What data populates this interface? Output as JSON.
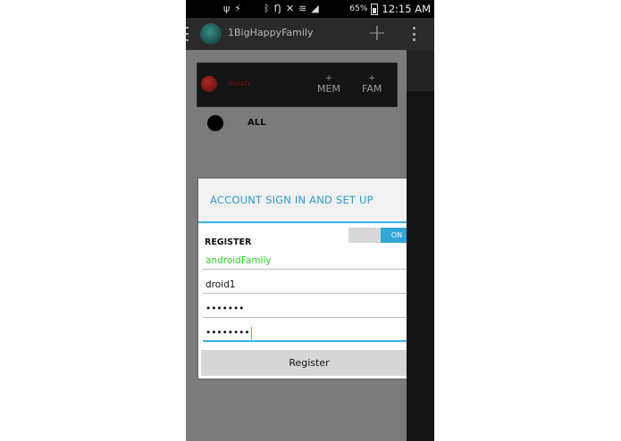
{
  "status_bar": {
    "icons": [
      "usb-icon",
      "no-sound-icon",
      "bluetooth-icon",
      "nfc-icon",
      "mute-icon",
      "wifi-icon",
      "signal-icon"
    ],
    "battery_percent": "65%",
    "time": "12:15 AM"
  },
  "action_bar": {
    "title": "1BigHappyFamily",
    "add_label": "+"
  },
  "drawer": {
    "member_name": "ouiah",
    "mem_plus": "+",
    "mem_label": "MEM",
    "fam_plus": "+",
    "fam_label": "FAM",
    "all_label": "ALL"
  },
  "dialog": {
    "title": "ACCOUNT SIGN IN AND SET UP",
    "register_label": "REGISTER",
    "toggle_state": "ON",
    "family_value": "androidFamily",
    "username_value": "droid1",
    "password_value": "•••••••",
    "confirm_password_value": "••••••••",
    "register_button": "Register"
  },
  "colors": {
    "accent": "#33b5e5",
    "title": "#2c9fcb",
    "family_text": "#28d428"
  }
}
